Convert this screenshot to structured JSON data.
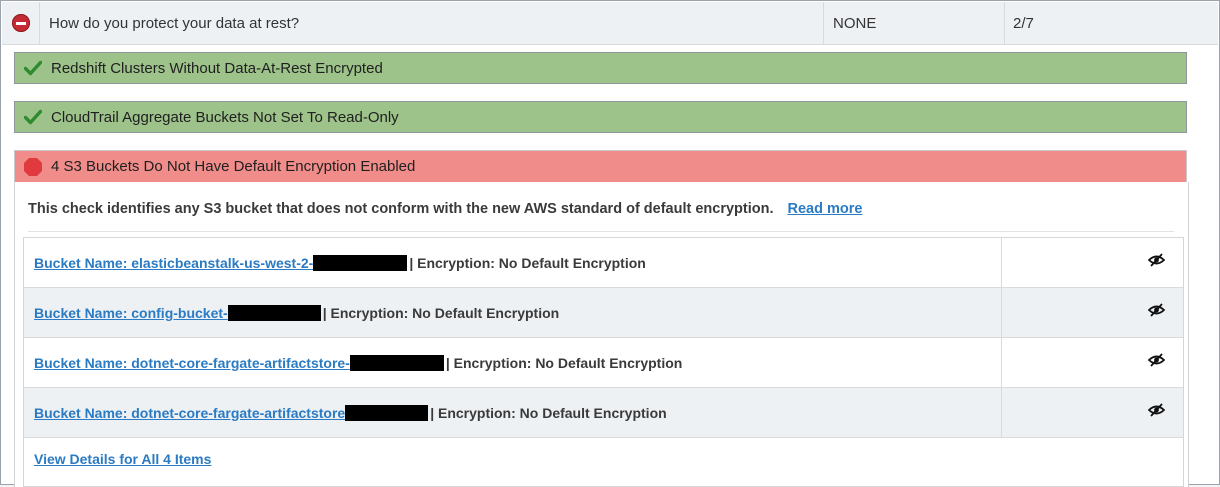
{
  "question": {
    "text": "How do you protect your data at rest?",
    "risk": "NONE",
    "score": "2/7",
    "icon": "no-entry-icon"
  },
  "checks": [
    {
      "label": "Redshift Clusters Without Data-At-Rest Encrypted",
      "status": "pass",
      "icon": "check-icon"
    },
    {
      "label": "CloudTrail Aggregate Buckets Not Set To Read-Only",
      "status": "pass",
      "icon": "check-icon"
    },
    {
      "label": "4 S3 Buckets Do Not Have Default Encryption Enabled",
      "status": "fail",
      "icon": "stop-octagon-icon"
    }
  ],
  "detail": {
    "description": "This check identifies any S3 bucket that does not conform with the new AWS standard of default encryption.",
    "read_more": "Read more",
    "rows": [
      {
        "link": "Bucket Name: elasticbeanstalk-us-west-2-",
        "suffix": "| Encryption: No Default Encryption",
        "action_icon": "hide-eye-icon"
      },
      {
        "link": "Bucket Name: config-bucket-",
        "suffix": "| Encryption: No Default Encryption",
        "action_icon": "hide-eye-icon"
      },
      {
        "link": "Bucket Name: dotnet-core-fargate-artifactstore-",
        "suffix": "| Encryption: No Default Encryption",
        "action_icon": "hide-eye-icon"
      },
      {
        "link": "Bucket Name: dotnet-core-fargate-artifactstore",
        "suffix": "| Encryption: No Default Encryption",
        "action_icon": "hide-eye-icon"
      }
    ],
    "view_all": "View Details for All 4 Items"
  },
  "colors": {
    "pass": "#9dc28a",
    "fail": "#f08d8a",
    "link": "#2a7bc3",
    "danger": "#c62b33"
  }
}
